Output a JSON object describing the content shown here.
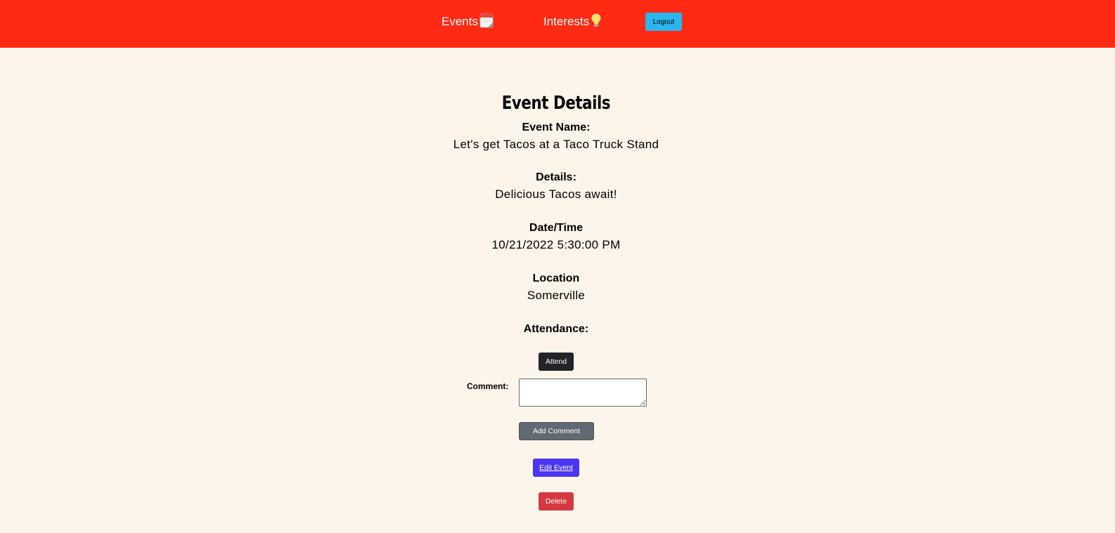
{
  "navbar": {
    "events_label": "Events",
    "events_icon": "calendar-icon",
    "interests_label": "Interests",
    "interests_icon": "lightbulb-icon",
    "logout_label": "Logout",
    "background_color": "#ff2a13",
    "logout_color": "#2bb6ee"
  },
  "event": {
    "title": "Event Details",
    "name_label": "Event Name:",
    "name_value": "Let's get Tacos at a Taco Truck Stand",
    "details_label": "Details:",
    "details_value": "Delicious Tacos await!",
    "datetime_label": "Date/Time",
    "datetime_value": "10/21/2022 5:30:00 PM",
    "location_label": "Location",
    "location_value": "Somerville",
    "attendance_label": "Attendance:"
  },
  "actions": {
    "attend_label": "Attend",
    "comment_label": "Comment:",
    "comment_value": "",
    "add_comment_label": "Add Comment",
    "edit_label": "Edit Event",
    "delete_label": "Delete"
  },
  "colors": {
    "page_background": "#fef5ea",
    "attend": "#222428",
    "add_comment": "#616972",
    "edit": "#4a36f2",
    "delete": "#d6383f"
  }
}
